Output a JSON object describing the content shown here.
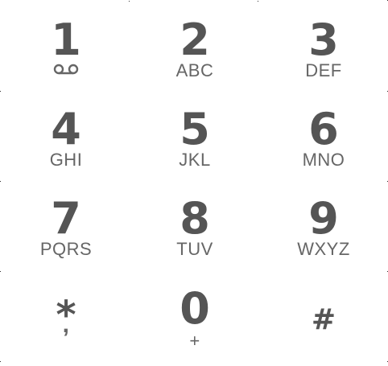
{
  "keys": [
    {
      "digit": "1",
      "letters": "",
      "icon": "voicemail-icon"
    },
    {
      "digit": "2",
      "letters": "ABC"
    },
    {
      "digit": "3",
      "letters": "DEF"
    },
    {
      "digit": "4",
      "letters": "GHI"
    },
    {
      "digit": "5",
      "letters": "JKL"
    },
    {
      "digit": "6",
      "letters": "MNO"
    },
    {
      "digit": "7",
      "letters": "PQRS"
    },
    {
      "digit": "8",
      "letters": "TUV"
    },
    {
      "digit": "9",
      "letters": "WXYZ"
    },
    {
      "digit": "*",
      "letters": ","
    },
    {
      "digit": "0",
      "letters": "+"
    },
    {
      "digit": "#",
      "letters": ""
    }
  ],
  "colors": {
    "digit": "#555555",
    "letters": "#666666",
    "background": "#ffffff"
  }
}
